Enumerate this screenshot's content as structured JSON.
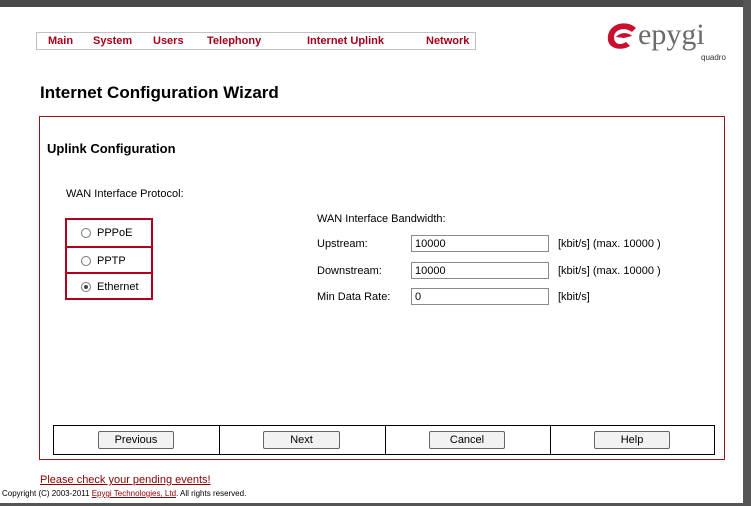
{
  "menu": {
    "items": [
      "Main",
      "System",
      "Users",
      "Telephony",
      "Internet Uplink",
      "Network"
    ]
  },
  "logo": {
    "word": "epygi",
    "sub": "quadro"
  },
  "page_title": "Internet Configuration Wizard",
  "section_title": "Uplink Configuration",
  "wan_protocol": {
    "label": "WAN Interface Protocol:",
    "options": [
      "PPPoE",
      "PPTP",
      "Ethernet"
    ],
    "selected": "Ethernet"
  },
  "bandwidth": {
    "label": "WAN Interface Bandwidth:",
    "upstream_label": "Upstream:",
    "upstream_value": "10000",
    "upstream_unit": "[kbit/s] (max. 10000 )",
    "downstream_label": "Downstream:",
    "downstream_value": "10000",
    "downstream_unit": "[kbit/s] (max. 10000 )",
    "min_rate_label": "Min Data Rate:",
    "min_rate_value": "0",
    "min_rate_unit": "[kbit/s]"
  },
  "buttons": {
    "previous": "Previous",
    "next": "Next",
    "cancel": "Cancel",
    "help": "Help"
  },
  "footer": {
    "pending": "Please check your pending events!",
    "copyright_prefix": "Copyright (C) 2003-2011 ",
    "copyright_link": "Epygi Technologies, Ltd",
    "copyright_suffix": ". All rights reserved."
  },
  "colors": {
    "accent": "#a3001a",
    "panel_border": "#8c1a1a"
  }
}
